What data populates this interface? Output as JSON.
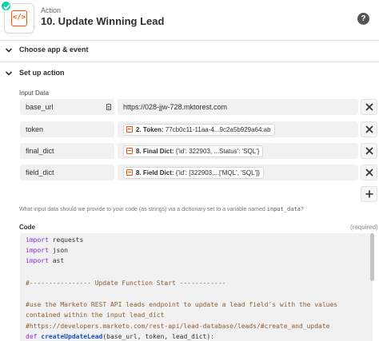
{
  "header": {
    "action_label": "Action",
    "title": "10. Update Winning Lead",
    "step_icon_text": "</>",
    "help_text": "?"
  },
  "sections": {
    "choose_app": "Choose app & event",
    "setup_action": "Set up action"
  },
  "input_data": {
    "label": "Input Data",
    "rows": [
      {
        "key": "base_url",
        "value": "https://028-jjw-728.mktorest.com"
      },
      {
        "key": "token",
        "pill_name": "2. Token:",
        "pill_value": "77cb0c11-11aa-4...9c2a5b929a64:ab"
      },
      {
        "key": "final_dict",
        "pill_name": "8. Final Dict:",
        "pill_value": "{'id': 322903, ...Status': 'SQL'}"
      },
      {
        "key": "field_dict",
        "pill_name": "8. Field Dict:",
        "pill_value": "{'id': [322903,...['MQL', 'SQL']}"
      }
    ]
  },
  "hint": {
    "text": "What input data should we provide to your code (as strings) via a dictionary set to a variable named ",
    "var": "input_data",
    "end": "?"
  },
  "code": {
    "label": "Code",
    "required": "(required)",
    "lines": {
      "l1_kw": "import",
      "l1_rest": " requests",
      "l2_kw": "import",
      "l2_rest": " json",
      "l3_kw": "import",
      "l3_rest": " ast",
      "l5": "#---------------- Update Function Start ------------",
      "l7": "#use the Marketo REST API leads endpoint to update a lead field's with the values",
      "l8": "contained within the input lead_dict",
      "l9": "#https://developers.marketo.com/rest-api/lead-database/leads/#create_and_update",
      "l10_kw": "def",
      "l10_fn": "createUpdateLead",
      "l10_rest": "(base_url, token, lead_dict):"
    }
  },
  "colors": {
    "accent": "#ff4f00",
    "success": "#13d0ab"
  }
}
